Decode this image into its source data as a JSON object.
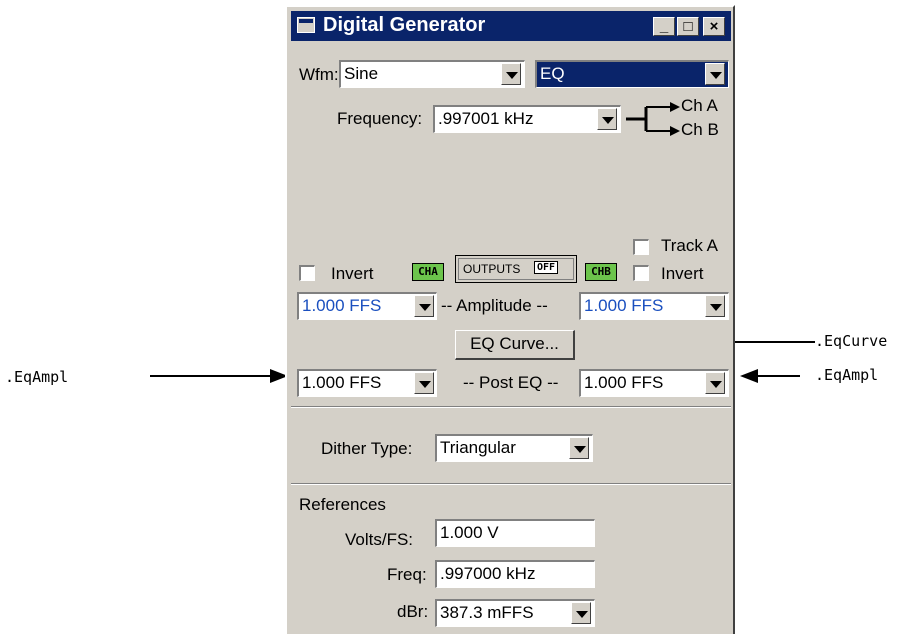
{
  "window": {
    "title": "Digital Generator",
    "minimize": "_",
    "maximize": "□",
    "close": "×"
  },
  "wfm": {
    "label": "Wfm:",
    "type": "Sine",
    "mode": "EQ"
  },
  "frequency": {
    "label": "Frequency:",
    "value": ".997001 kHz",
    "route_a": "Ch A",
    "route_b": "Ch B"
  },
  "track_a": {
    "label": "Track A"
  },
  "outputs": {
    "invert_left_label": "Invert",
    "invert_right_label": "Invert",
    "cha_badge": "CHA",
    "chb_badge": "CHB",
    "outputs_label": "OUTPUTS",
    "outputs_state": "OFF"
  },
  "amplitude": {
    "label": "-- Amplitude --",
    "left": "1.000   FFS",
    "right": "1.000   FFS"
  },
  "eq_curve_button": "EQ Curve...",
  "post_eq": {
    "label": "-- Post EQ --",
    "left": "1.000   FFS",
    "right": "1.000   FFS"
  },
  "dither": {
    "label": "Dither Type:",
    "value": "Triangular"
  },
  "references": {
    "heading": "References",
    "volts_label": "Volts/FS:",
    "volts_value": "1.000   V",
    "freq_label": "Freq:",
    "freq_value": ".997000 kHz",
    "dbr_label": "dBr:",
    "dbr_value": "387.3   mFFS"
  },
  "annotations": {
    "left_eqampl": ".EqAmpl",
    "right_eqcurve": ".EqCurve",
    "right_eqampl": ".EqAmpl"
  }
}
